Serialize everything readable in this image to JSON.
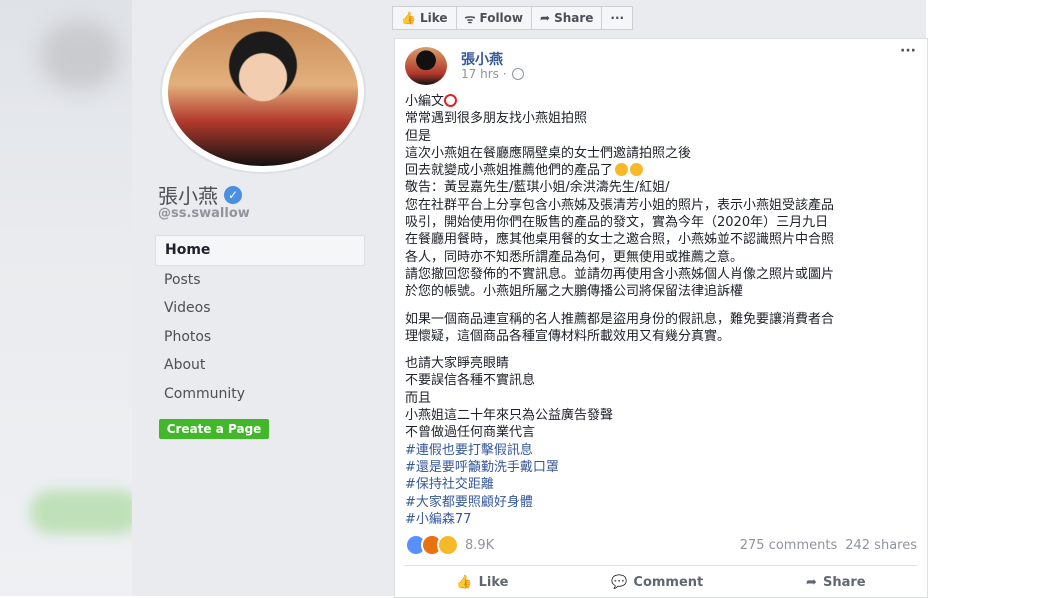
{
  "page": {
    "name": "張小燕",
    "handle": "@ss.swallow",
    "nav": [
      "Home",
      "Posts",
      "Videos",
      "Photos",
      "About",
      "Community"
    ],
    "create_page": "Create a Page"
  },
  "actionbar": {
    "like": "Like",
    "follow": "Follow",
    "share": "Share",
    "more": "···"
  },
  "post": {
    "author": "張小燕",
    "time": "17 hrs ·",
    "more": "···",
    "lines_a": [
      "小編文",
      "常常遇到很多朋友找小燕姐拍照",
      "但是",
      "這次小燕姐在餐廳應隔壁桌的女士們邀請拍照之後",
      "回去就變成小燕姐推薦他們的產品了",
      "敬告：黃昱嘉先生/藍琪小姐/余洪濤先生/紅姐/",
      "您在社群平台上分享包含小燕姊及張清芳小姐的照片，表示小燕姐受該產品",
      "吸引，開始使用你們在販售的產品的發文，實為今年（2020年）三月九日",
      "在餐廳用餐時，應其他桌用餐的女士之邀合照，小燕姊並不認識照片中合照",
      "各人，同時亦不知悉所謂產品為何，更無使用或推薦之意。",
      "請您撤回您發佈的不實訊息。並請勿再使用含小燕姊個人肖像之照片或圖片",
      "於您的帳號。小燕姐所屬之大鵬傳播公司將保留法律追訴權"
    ],
    "lines_b": [
      "如果一個商品連宣稱的名人推薦都是盜用身份的假訊息，難免要讓消費者合",
      "理懷疑，這個商品各種宣傳材料所載效用又有幾分真實。"
    ],
    "lines_c": [
      "也請大家睜亮眼睛",
      "不要誤信各種不實訊息",
      "而且",
      "小燕姐這二十年來只為公益廣告發聲",
      "不曾做過任何商業代言"
    ],
    "hashtags": [
      "#連假也要打擊假訊息",
      "#還是要呼籲勤洗手戴口罩",
      "#保持社交距離",
      "#大家都要照顧好身體",
      "#小編森77"
    ],
    "reactions_count": "8.9K",
    "comments": "275 comments",
    "shares": "242 shares",
    "actions": {
      "like": "Like",
      "comment": "Comment",
      "share": "Share"
    }
  }
}
